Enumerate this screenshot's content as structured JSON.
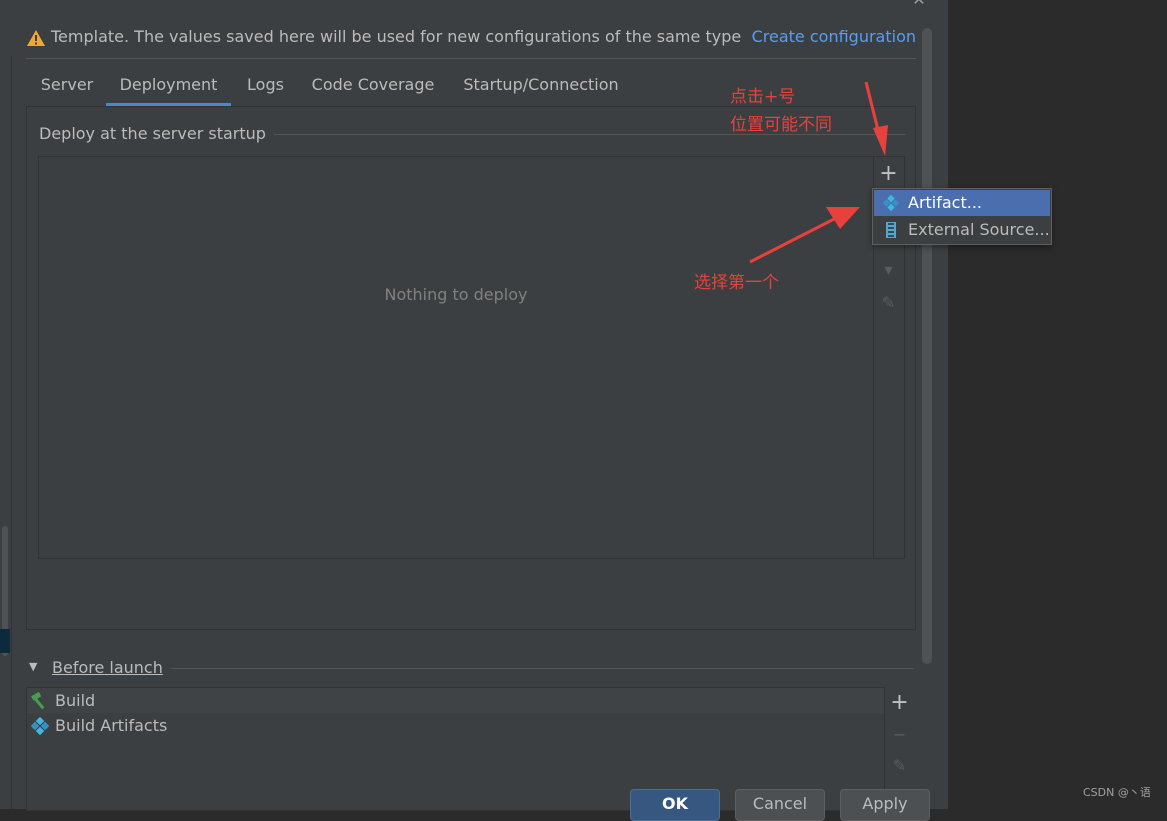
{
  "banner": {
    "icon": "warning-icon",
    "text": "Template. The values saved here will be used for new configurations of the same type",
    "link": "Create configuration"
  },
  "tabs": [
    {
      "label": "Server"
    },
    {
      "label": "Deployment",
      "active": true
    },
    {
      "label": "Logs"
    },
    {
      "label": "Code Coverage"
    },
    {
      "label": "Startup/Connection"
    }
  ],
  "deploy": {
    "group_title": "Deploy at the server startup",
    "empty_text": "Nothing to deploy",
    "toolbar": {
      "add": "+",
      "down": "▾",
      "edit": "✎"
    }
  },
  "popup": {
    "items": [
      {
        "label": "Artifact...",
        "icon": "artifact-icon",
        "selected": true
      },
      {
        "label": "External Source...",
        "icon": "external-source-icon"
      }
    ]
  },
  "annotations": {
    "line1": "点击+号",
    "line2": "位置可能不同",
    "line3": "选择第一个",
    "color": "#e8413b"
  },
  "before_launch": {
    "title": "Before launch",
    "items": [
      {
        "label": "Build",
        "icon": "hammer-icon"
      },
      {
        "label": "Build Artifacts",
        "icon": "artifact-icon"
      }
    ],
    "toolbar": {
      "add": "+",
      "remove": "−",
      "edit": "✎"
    }
  },
  "buttons": {
    "ok": "OK",
    "cancel": "Cancel",
    "apply": "Apply"
  },
  "watermark": "CSDN @丶语",
  "colors": {
    "accent": "#4a88c7",
    "link": "#589df6",
    "selection": "#4b6eaf",
    "background": "#3c3f41"
  }
}
